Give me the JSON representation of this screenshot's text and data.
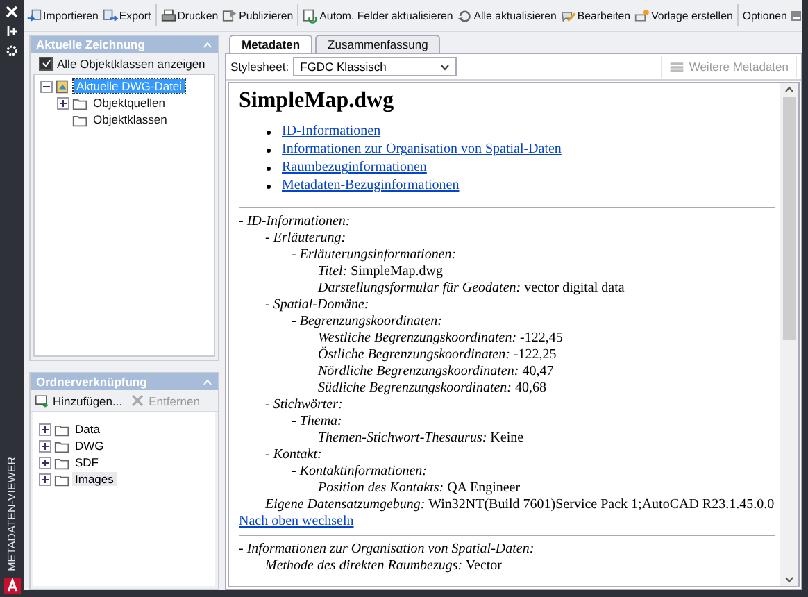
{
  "side_strip": {
    "title": "METADATEN-VIEWER"
  },
  "toolbar": {
    "groups": [
      [
        {
          "label": "Importieren"
        },
        {
          "label": "Export"
        }
      ],
      [
        {
          "label": "Drucken"
        },
        {
          "label": "Publizieren"
        }
      ],
      [
        {
          "label": "Autom. Felder aktualisieren"
        },
        {
          "label": "Alle aktualisieren"
        },
        {
          "label": "Bearbeiten"
        },
        {
          "label": "Vorlage erstellen"
        }
      ],
      [
        {
          "label": "Optionen"
        }
      ]
    ]
  },
  "drawing_panel": {
    "title": "Aktuelle Zeichnung",
    "show_all": {
      "label": "Alle Objektklassen anzeigen",
      "checked": true
    },
    "tree": [
      {
        "label": "Aktuelle DWG-Datei",
        "selected": true,
        "expanded": true,
        "children": [
          {
            "label": "Objektquellen",
            "selected": false,
            "expanded": false
          },
          {
            "label": "Objektklassen",
            "selected": false
          }
        ]
      }
    ]
  },
  "folder_panel": {
    "title": "Ordnerverknüpfung",
    "actions": [
      {
        "label": "Hinzufügen...",
        "disabled": false
      },
      {
        "label": "Entfernen",
        "disabled": true
      }
    ],
    "folders": [
      {
        "label": "Data",
        "selected": false,
        "expanded": false
      },
      {
        "label": "DWG",
        "selected": false,
        "expanded": false
      },
      {
        "label": "SDF",
        "selected": false,
        "expanded": false
      },
      {
        "label": "Images",
        "selected": true,
        "expanded": false
      }
    ]
  },
  "tabs": [
    {
      "label": "Metadaten",
      "selected": true
    },
    {
      "label": "Zusammenfassung",
      "selected": false
    }
  ],
  "stylesheet": {
    "label": "Stylesheet:",
    "value": "FGDC Klassisch"
  },
  "more_button": {
    "label": "Weitere Metadaten",
    "disabled": true
  },
  "document": {
    "title": "SimpleMap.dwg",
    "links": [
      "ID-Informationen",
      "Informationen zur Organisation von Spatial-Daten",
      "Raumbezuginformationen",
      "Metadaten-Bezuginformationen"
    ],
    "sections": [
      {
        "top_link": "Nach oben wechseln",
        "entries": [
          {
            "label": "- ID-Informationen:",
            "children": [
              {
                "label": "- Erläuterung:",
                "children": [
                  {
                    "label": "- Erläuterungsinformationen:",
                    "children": [
                      {
                        "label": "Titel:",
                        "value": "SimpleMap.dwg"
                      },
                      {
                        "label": "Darstellungsformular für Geodaten:",
                        "value": "vector digital data"
                      }
                    ]
                  }
                ]
              },
              {
                "label": "- Spatial-Domäne:",
                "children": [
                  {
                    "label": "- Begrenzungskoordinaten:",
                    "children": [
                      {
                        "label": "Westliche Begrenzungskoordinaten:",
                        "value": "-122,45"
                      },
                      {
                        "label": "Östliche Begrenzungskoordinaten:",
                        "value": "-122,25"
                      },
                      {
                        "label": "Nördliche Begrenzungskoordinaten:",
                        "value": "40,47"
                      },
                      {
                        "label": "Südliche Begrenzungskoordinaten:",
                        "value": "40,68"
                      }
                    ]
                  }
                ]
              },
              {
                "label": "- Stichwörter:",
                "children": [
                  {
                    "label": "- Thema:",
                    "children": [
                      {
                        "label": "Themen-Stichwort-Thesaurus:",
                        "value": "Keine"
                      }
                    ]
                  }
                ]
              },
              {
                "label": "- Kontakt:",
                "children": [
                  {
                    "label": "- Kontaktinformationen:",
                    "children": [
                      {
                        "label": "Position des Kontakts:",
                        "value": "QA Engineer"
                      }
                    ]
                  }
                ]
              },
              {
                "label": "Eigene Datensatzumgebung:",
                "value": "Win32NT(Build 7601)Service Pack 1;AutoCAD R23.1.45.0.0"
              }
            ]
          }
        ]
      },
      {
        "entries": [
          {
            "label": "- Informationen zur Organisation von Spatial-Daten:",
            "children": [
              {
                "label": "Methode des direkten Raumbezugs:",
                "value": "Vector"
              }
            ]
          }
        ]
      }
    ]
  }
}
